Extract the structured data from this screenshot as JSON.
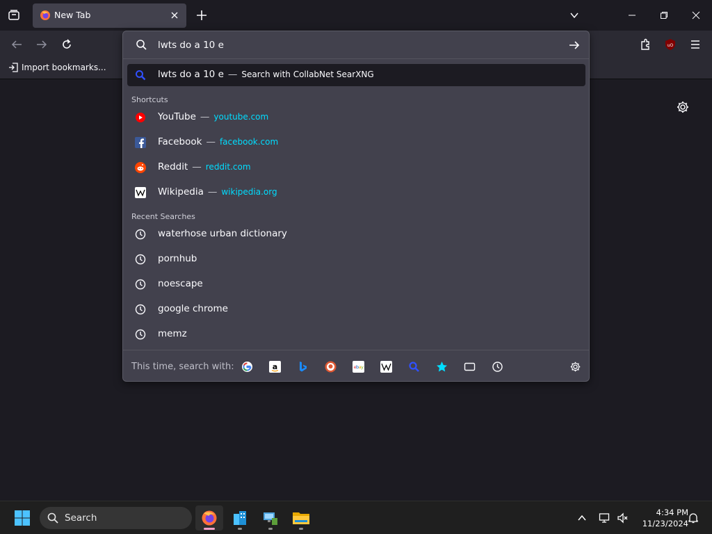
{
  "browser": {
    "tab_title": "New Tab",
    "bookmark_import": "Import bookmarks..."
  },
  "urlbar": {
    "query": "lwts do a 10 e",
    "search_suggestion": {
      "text": "lwts do a 10 e",
      "action": "Search with CollabNet SearXNG"
    },
    "shortcuts_label": "Shortcuts",
    "shortcuts": [
      {
        "title": "YouTube",
        "url": "youtube.com",
        "icon": "youtube-icon"
      },
      {
        "title": "Facebook",
        "url": "facebook.com",
        "icon": "facebook-icon"
      },
      {
        "title": "Reddit",
        "url": "reddit.com",
        "icon": "reddit-icon"
      },
      {
        "title": "Wikipedia",
        "url": "wikipedia.org",
        "icon": "wikipedia-icon"
      }
    ],
    "recent_label": "Recent Searches",
    "recent": [
      "waterhose urban dictionary",
      "pornhub",
      "noescape",
      "google chrome",
      "memz"
    ],
    "footer_label": "This time, search with:",
    "separator": "—"
  },
  "taskbar": {
    "search_placeholder": "Search",
    "time": "4:34 PM",
    "date": "11/23/2024"
  },
  "colors": {
    "accent_url": "#00ddff",
    "panel_bg": "#42414d",
    "selected_bg": "#1c1b22"
  }
}
